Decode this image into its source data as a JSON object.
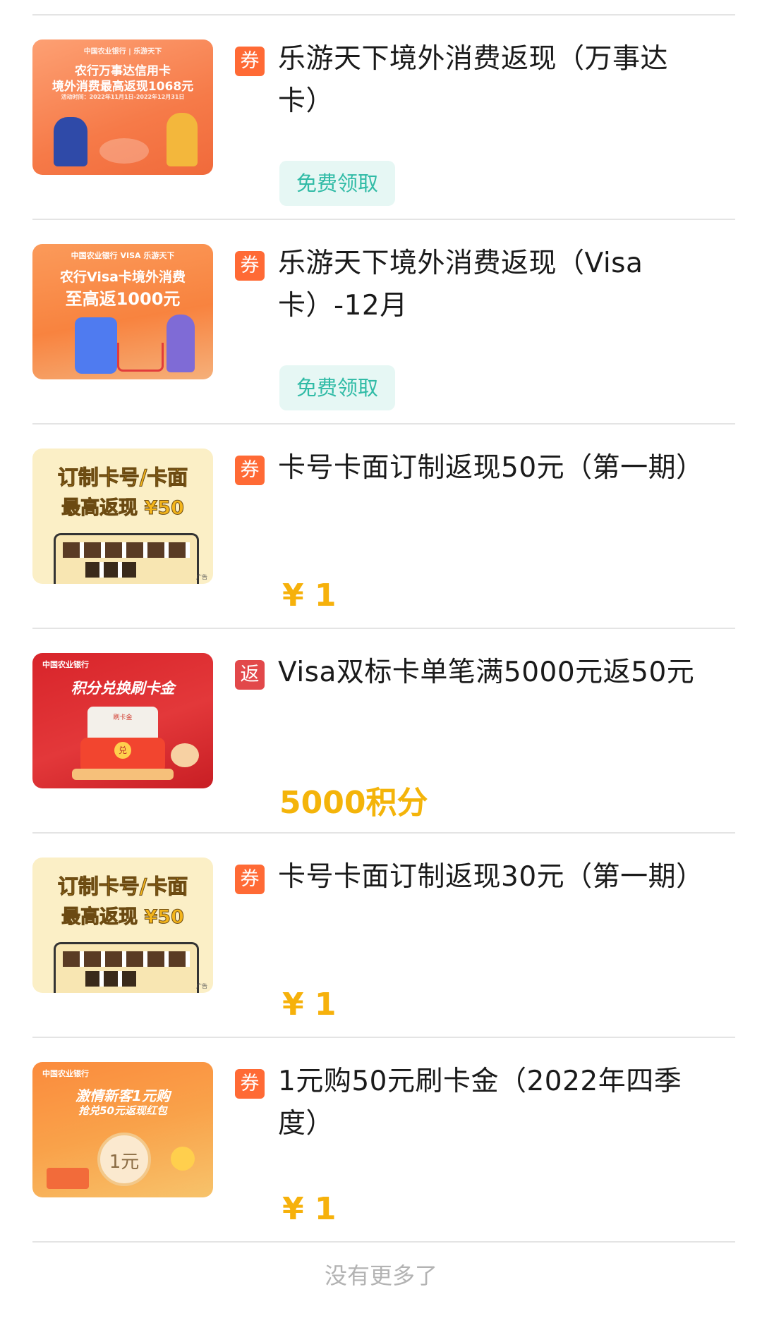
{
  "items": [
    {
      "thumb": {
        "line1": "中国农业银行 | 乐游天下",
        "line2": "农行万事达信用卡",
        "line3": "境外消费最高返现1068元",
        "line4": "活动时间：2022年11月1日-2022年12月31日"
      },
      "tag": "券",
      "title": "乐游天下境外消费返现（万事达卡）",
      "action": "免费领取"
    },
    {
      "thumb": {
        "line1": "中国农业银行 VISA 乐游天下",
        "line2": "农行Visa卡境外消费",
        "line3": "至高返1000元"
      },
      "tag": "券",
      "title": "乐游天下境外消费返现（Visa卡）-12月",
      "action": "免费领取"
    },
    {
      "thumb": {
        "line1": "订制卡号/卡面",
        "line2": "最高返现 ¥50",
        "ad": "广告"
      },
      "tag": "券",
      "title": "卡号卡面订制返现50元（第一期）",
      "price": "¥ 1"
    },
    {
      "thumb": {
        "line1": "中国农业银行",
        "line2": "积分兑换刷卡金",
        "line3": "刷卡金",
        "line4": "兑"
      },
      "tag": "返",
      "title": "Visa双标卡单笔满5000元返50元",
      "price": "5000积分"
    },
    {
      "thumb": {
        "line1": "订制卡号/卡面",
        "line2": "最高返现 ¥50",
        "ad": "广告"
      },
      "tag": "券",
      "title": "卡号卡面订制返现30元（第一期）",
      "price": "¥ 1"
    },
    {
      "thumb": {
        "line1": "中国农业银行",
        "line2": "激情新客1元购",
        "line3": "抢兑50元返现红包",
        "line4": "1元"
      },
      "tag": "券",
      "title": "1元购50元刷卡金（2022年四季度）",
      "price": "¥ 1"
    }
  ],
  "footer": "没有更多了",
  "colors": {
    "coupon_tag": "#ff6a35",
    "rebate_tag": "#e2484a",
    "price": "#f6b10b",
    "action_text": "#30bba6",
    "action_bg": "#e6f7f4"
  }
}
